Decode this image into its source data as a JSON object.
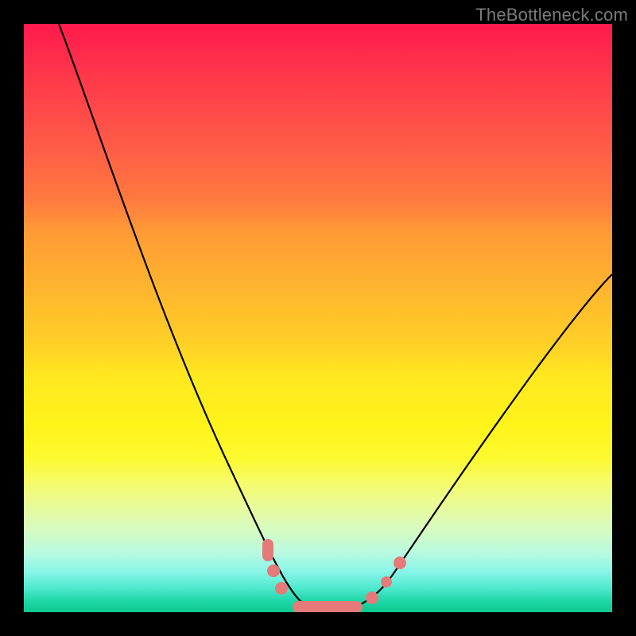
{
  "watermark": "TheBottleneck.com",
  "colors": {
    "frame": "#000000",
    "curve": "#000000",
    "marker": "#e67a7a"
  },
  "chart_data": {
    "type": "line",
    "title": "",
    "xlabel": "",
    "ylabel": "",
    "xlim": [
      0,
      100
    ],
    "ylim": [
      0,
      100
    ],
    "grid": false,
    "legend": false,
    "note": "V-shaped bottleneck curve. Y represents bottleneck severity (0 = optimal / green band at bottom, 100 = severe / red at top). X is an unlabeled configuration axis. Values are read off the visual since no tick labels are shown.",
    "series": [
      {
        "name": "bottleneck-curve",
        "x": [
          6,
          10,
          15,
          20,
          25,
          30,
          35,
          38,
          40,
          42,
          44,
          46,
          48,
          50,
          52,
          54,
          56,
          58,
          60,
          62,
          65,
          70,
          75,
          80,
          85,
          90,
          95,
          100
        ],
        "values": [
          100,
          90,
          78,
          66,
          54,
          42,
          30,
          21,
          15,
          10,
          6,
          3,
          1,
          0,
          0,
          0,
          1,
          3,
          6,
          9,
          13,
          19,
          25,
          31,
          37,
          42,
          47,
          52
        ]
      }
    ],
    "markers": {
      "name": "highlighted-points",
      "note": "salmon dots/pills near the curve minimum and lower knees",
      "points": [
        {
          "x": 41,
          "y": 11
        },
        {
          "x": 42,
          "y": 8
        },
        {
          "x": 44,
          "y": 4
        },
        {
          "x": 48,
          "y": 0
        },
        {
          "x": 52,
          "y": 0
        },
        {
          "x": 56,
          "y": 0
        },
        {
          "x": 59,
          "y": 3
        },
        {
          "x": 61,
          "y": 6
        },
        {
          "x": 63,
          "y": 10
        }
      ]
    }
  }
}
